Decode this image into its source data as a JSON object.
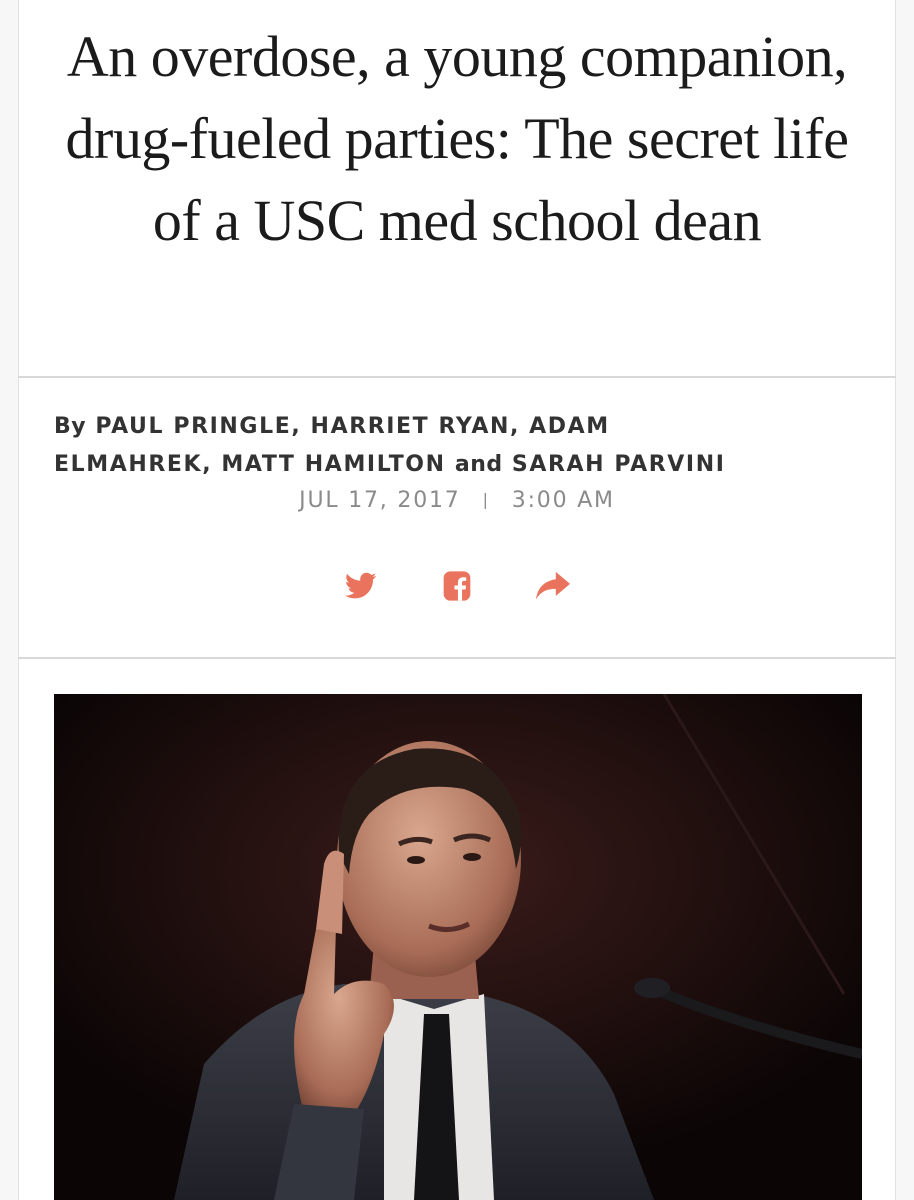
{
  "article": {
    "headline": "An overdose, a young companion, drug-fueled parties: The secret life of a USC med school dean",
    "byline": {
      "prefix": "By",
      "authors_line1": "PAUL PRINGLE, HARRIET RYAN, ADAM",
      "authors_line2a": "ELMAHREK, MATT HAMILTON",
      "conjunction": "and",
      "authors_line2b": "SARAH PARVINI"
    },
    "date": "JUL 17, 2017",
    "separator": "|",
    "time": "3:00 AM"
  },
  "share": {
    "accent_color": "#e9735c",
    "icons": [
      "twitter-icon",
      "facebook-icon",
      "share-arrow-icon"
    ]
  },
  "photo": {
    "alt": "Man in dark suit speaking at a microphone, raising one finger"
  }
}
